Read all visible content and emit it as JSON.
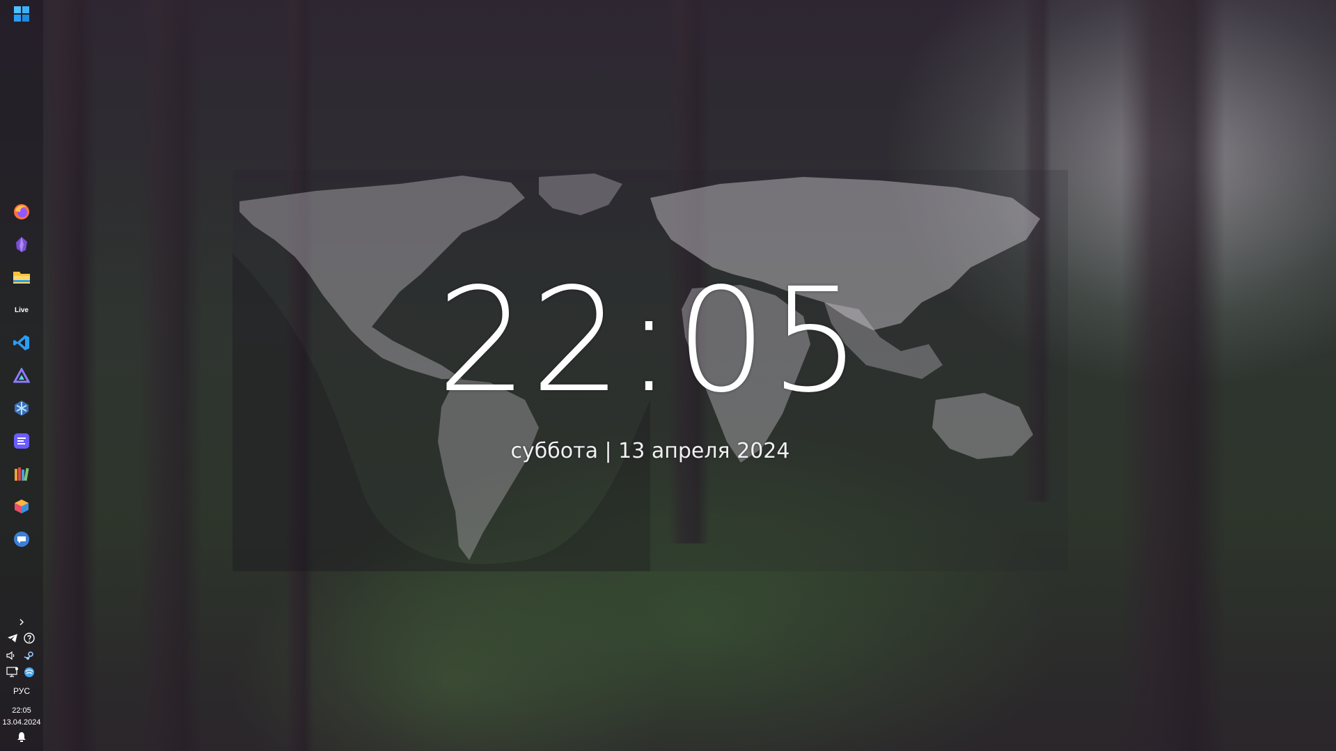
{
  "widget": {
    "time": "22:05",
    "date": "суббота | 13 апреля 2024"
  },
  "taskbar": {
    "pinned_apps": [
      {
        "name": "start-menu",
        "icon": "windows-logo-icon"
      },
      {
        "name": "firefox",
        "icon": "firefox-icon"
      },
      {
        "name": "obsidian",
        "icon": "obsidian-icon"
      },
      {
        "name": "file-explorer",
        "icon": "folder-icon"
      },
      {
        "name": "live",
        "icon": "live-text-icon",
        "label": "Live"
      },
      {
        "name": "vs-code",
        "icon": "vscode-icon"
      },
      {
        "name": "affinity",
        "icon": "triangle-app-icon"
      },
      {
        "name": "app-hex",
        "icon": "hexagon-app-icon"
      },
      {
        "name": "app-notes",
        "icon": "notes-app-icon"
      },
      {
        "name": "library",
        "icon": "books-icon"
      },
      {
        "name": "app-cube",
        "icon": "cube-app-icon"
      },
      {
        "name": "messenger",
        "icon": "chat-bubble-icon"
      }
    ],
    "tray": {
      "overflow_icon": "chevron-right-icon",
      "icons": [
        "telegram-icon",
        "help-circle-icon",
        "volume-icon",
        "steam-icon",
        "display-icon",
        "network-globe-icon"
      ],
      "language": "РУС",
      "time": "22:05",
      "date": "13.04.2024",
      "notification_icon": "bell-icon"
    }
  },
  "colors": {
    "taskbar_bg": "#18141c",
    "accent_blue": "#2a9df4",
    "text": "#ffffff"
  }
}
